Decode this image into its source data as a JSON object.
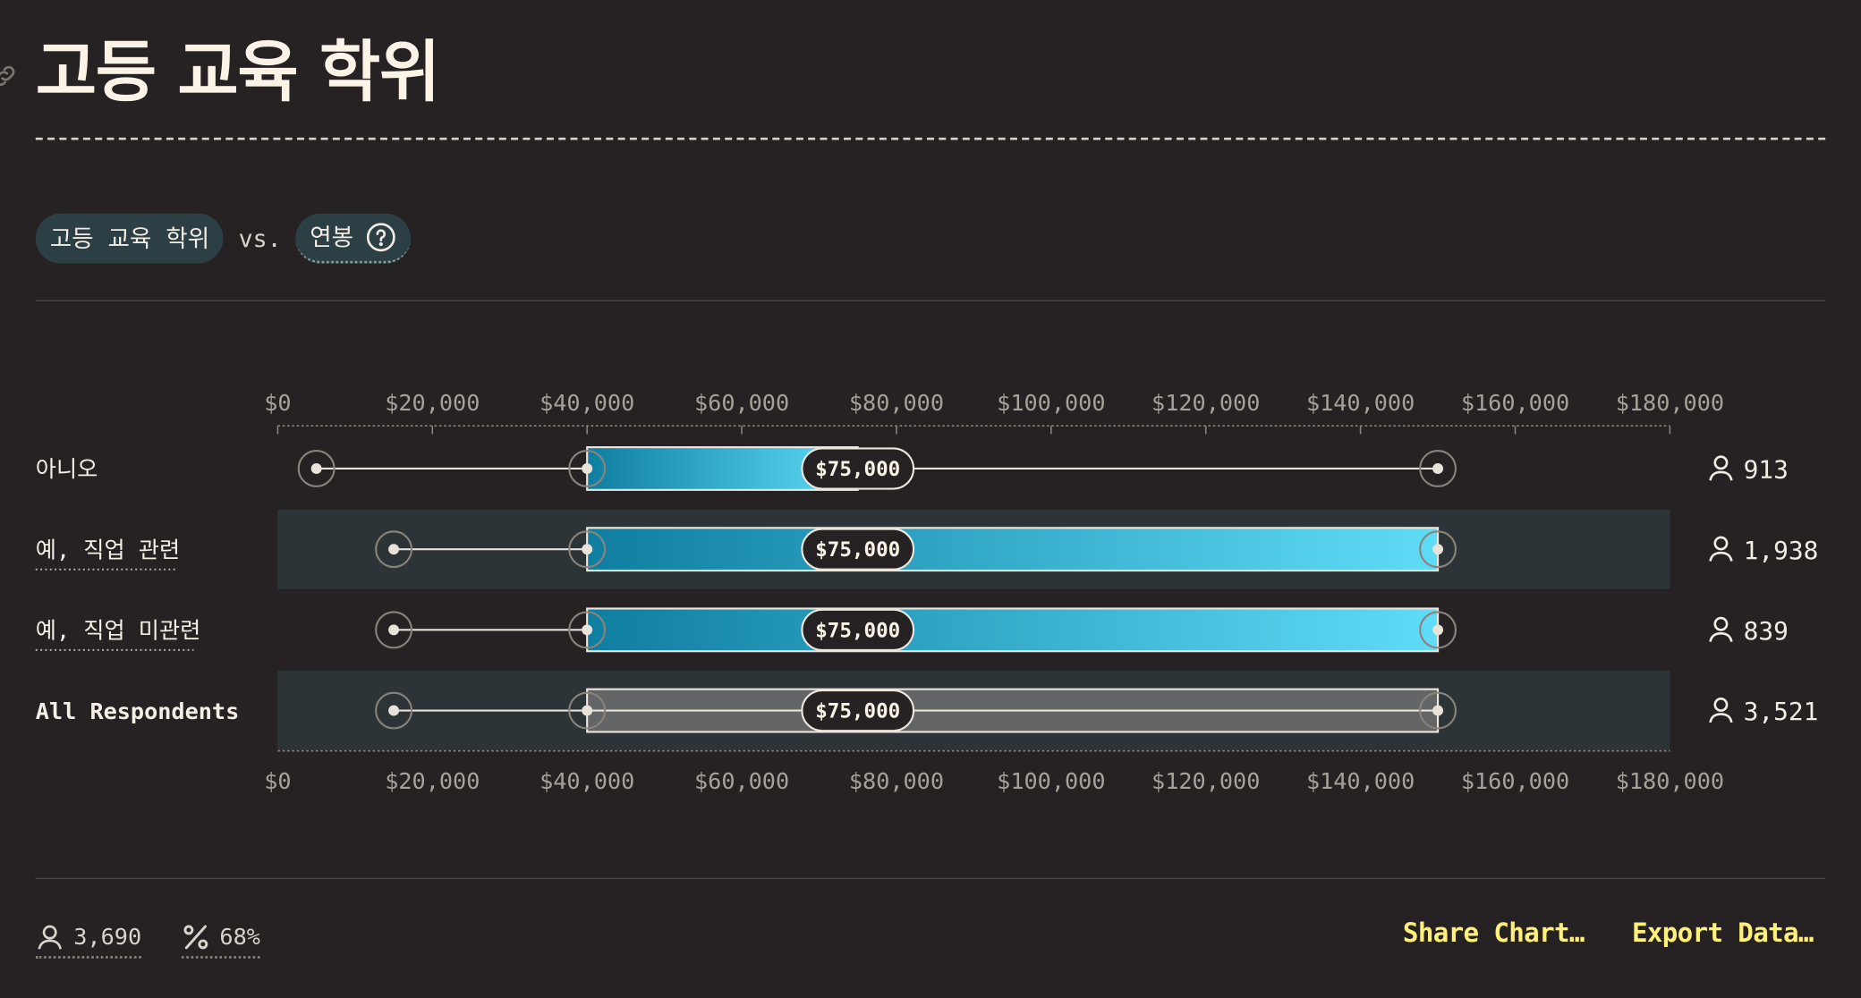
{
  "page": {
    "title": "고등 교육 학위"
  },
  "filters": {
    "primary": "고등 교육 학위",
    "vs": "vs.",
    "secondary": "연봉"
  },
  "footer": {
    "respondents": "3,690",
    "percent": "68%",
    "share": "Share Chart…",
    "export": "Export Data…"
  },
  "colors": {
    "background": "#262223",
    "row_highlight": "#2c3437",
    "bar_gradient_start": "#0f7ea0",
    "bar_gradient_end": "#5fdcf8",
    "all_bar": "#636566",
    "link": "#fff07a"
  },
  "chart_data": {
    "type": "range_bar",
    "x_ticks": [
      "$0",
      "$20,000",
      "$40,000",
      "$60,000",
      "$80,000",
      "$100,000",
      "$120,000",
      "$140,000",
      "$160,000",
      "$180,000"
    ],
    "xlim": [
      0,
      180000
    ],
    "rows": [
      {
        "label": "아니오",
        "min": 5000,
        "q1": 40000,
        "median": 75000,
        "q3": 75000,
        "max": 150000,
        "median_label": "$75,000",
        "count": "913",
        "highlight": false,
        "dotted": false,
        "bold": false,
        "all": false
      },
      {
        "label": "예, 직업 관련",
        "min": 15000,
        "q1": 40000,
        "median": 75000,
        "q3": 150000,
        "max": 150000,
        "median_label": "$75,000",
        "count": "1,938",
        "highlight": true,
        "dotted": true,
        "bold": false,
        "all": false
      },
      {
        "label": "예, 직업 미관련",
        "min": 15000,
        "q1": 40000,
        "median": 75000,
        "q3": 150000,
        "max": 150000,
        "median_label": "$75,000",
        "count": "839",
        "highlight": false,
        "dotted": true,
        "bold": false,
        "all": false
      },
      {
        "label": "All Respondents",
        "min": 15000,
        "q1": 40000,
        "median": 75000,
        "q3": 150000,
        "max": 150000,
        "median_label": "$75,000",
        "count": "3,521",
        "highlight": true,
        "dotted": false,
        "bold": true,
        "all": true
      }
    ]
  }
}
